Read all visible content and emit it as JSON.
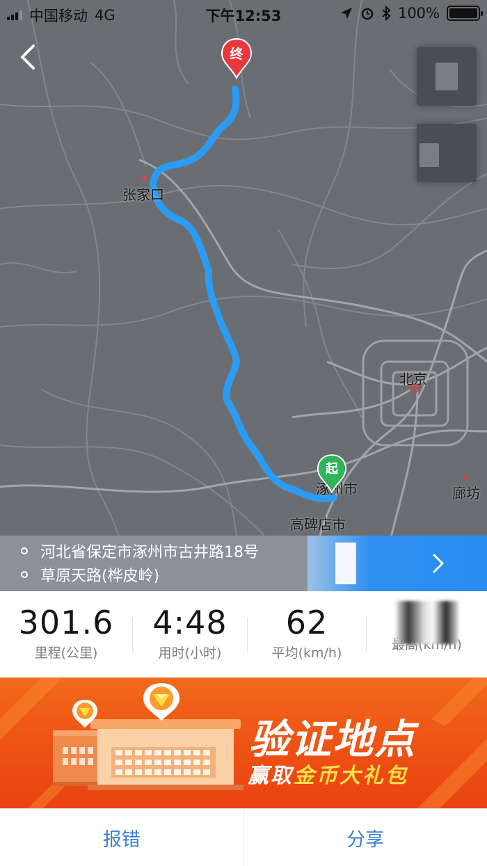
{
  "status_bar": {
    "carrier": "中国移动",
    "network": "4G",
    "time": "下午12:53",
    "battery": "100%",
    "icons": [
      "location-arrow-icon",
      "alarm-icon",
      "bluetooth-icon",
      "battery-icon"
    ]
  },
  "map": {
    "labels": {
      "zhangjiakou": "张家口",
      "beijing": "北京",
      "zhuozhou": "涿州市",
      "langfang": "廊坊",
      "gaobeidian": "高碑店市"
    },
    "start_marker": "起",
    "end_marker": "终",
    "route_color": "#2b9bf4",
    "start_color": "#2fb45a",
    "end_color": "#e8383d"
  },
  "route": {
    "start_address": "河北省保定市涿州市古井路18号",
    "end_address": "草原天路(桦皮岭)"
  },
  "stats": [
    {
      "value": "301.6",
      "label": "里程(公里)"
    },
    {
      "value": "4:48",
      "label": "用时(小时)"
    },
    {
      "value": "62",
      "label": "平均(km/h)"
    },
    {
      "value": "",
      "label": "最高(km/h)"
    }
  ],
  "banner": {
    "title": "验证地点",
    "subtitle_prefix": "赢取",
    "subtitle_highlight": "金币大礼包"
  },
  "actions": {
    "report": "报错",
    "share": "分享"
  }
}
